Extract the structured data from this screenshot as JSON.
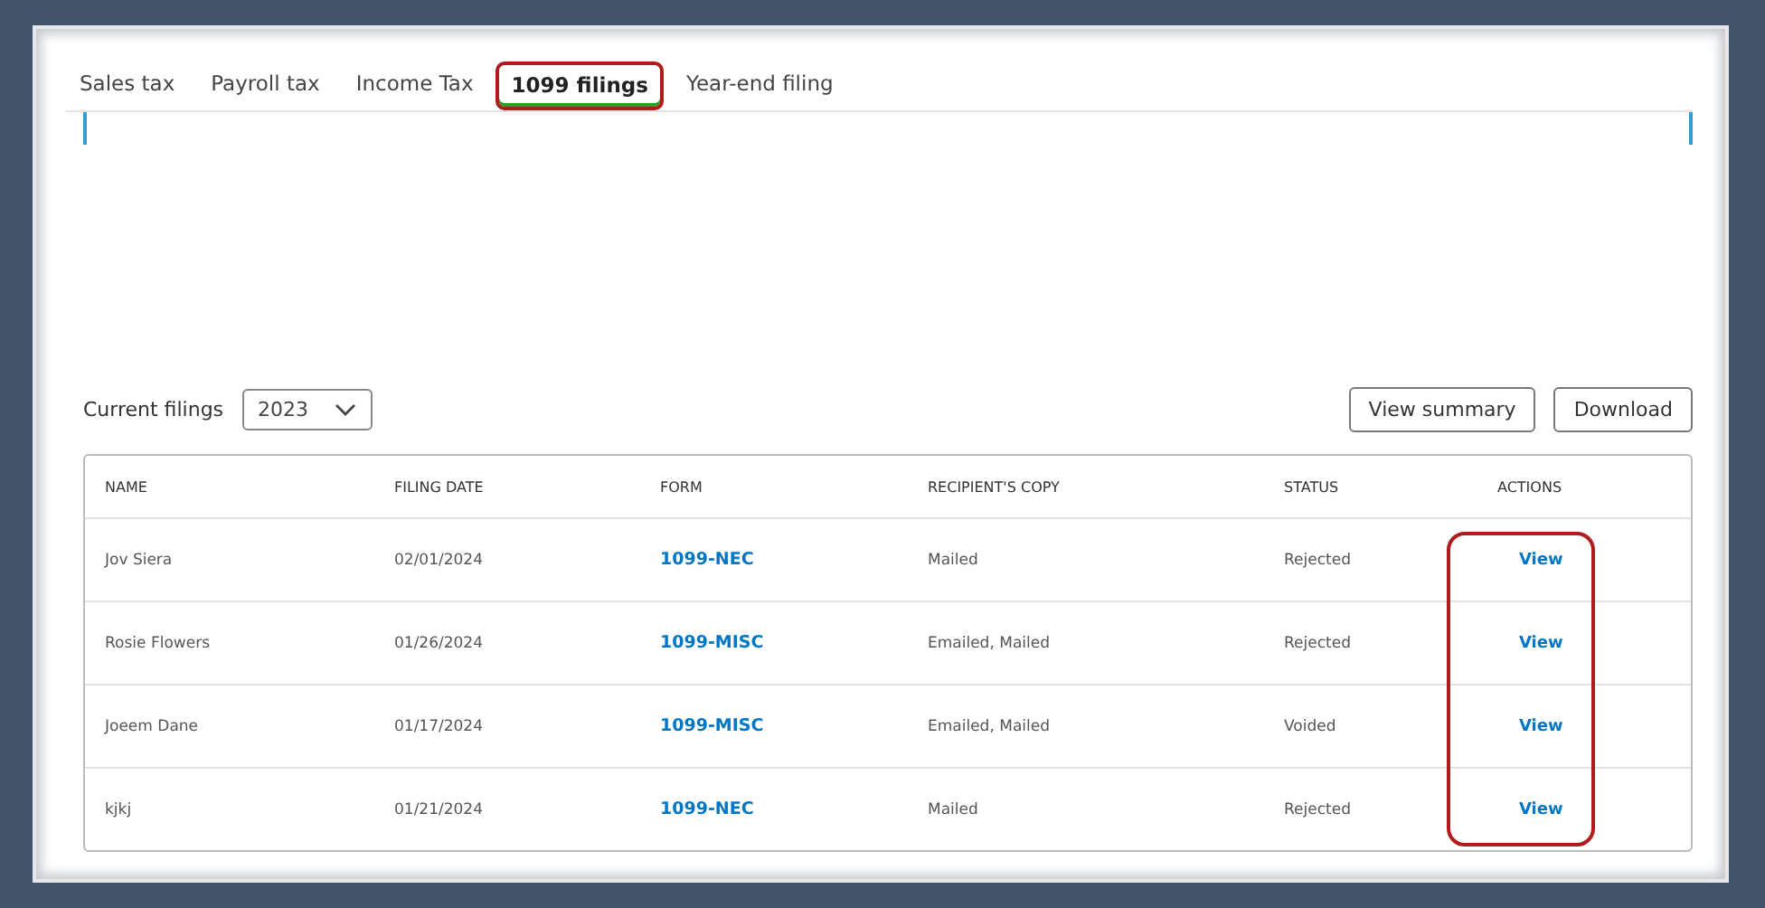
{
  "tabs": [
    {
      "label": "Sales tax",
      "selected": false
    },
    {
      "label": "Payroll tax",
      "selected": false
    },
    {
      "label": "Income Tax",
      "selected": false
    },
    {
      "label": "1099 filings",
      "selected": true
    },
    {
      "label": "Year-end filing",
      "selected": false
    }
  ],
  "filings": {
    "label": "Current filings",
    "year": "2023",
    "buttons": [
      "View summary",
      "Download"
    ]
  },
  "table": {
    "columns": [
      "NAME",
      "FILING DATE",
      "FORM",
      "RECIPIENT'S COPY",
      "STATUS",
      "ACTIONS"
    ],
    "rows": [
      {
        "name": "Jov Siera",
        "filing_date": "02/01/2024",
        "form": "1099-NEC",
        "recipients_copy": "Mailed",
        "status": "Rejected",
        "action": "View"
      },
      {
        "name": "Rosie Flowers",
        "filing_date": "01/26/2024",
        "form": "1099-MISC",
        "recipients_copy": "Emailed, Mailed",
        "status": "Rejected",
        "action": "View"
      },
      {
        "name": "Joeem Dane",
        "filing_date": "01/17/2024",
        "form": "1099-MISC",
        "recipients_copy": "Emailed, Mailed",
        "status": "Voided",
        "action": "View"
      },
      {
        "name": "kjkj",
        "filing_date": "01/21/2024",
        "form": "1099-NEC",
        "recipients_copy": "Mailed",
        "status": "Rejected",
        "action": "View"
      }
    ]
  }
}
